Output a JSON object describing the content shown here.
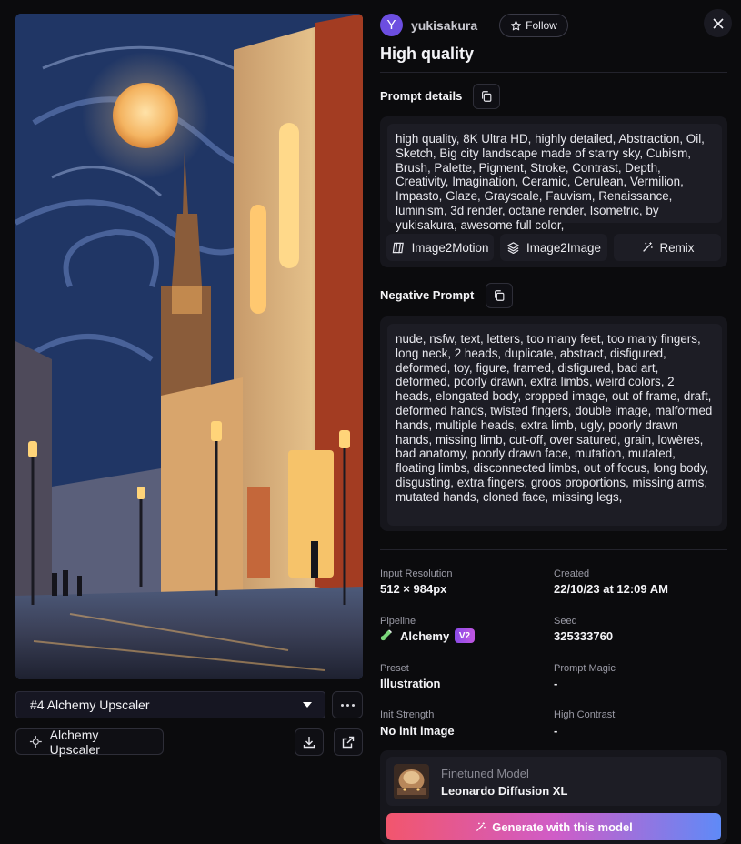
{
  "creator": {
    "avatar_letter": "Y",
    "username": "yukisakura",
    "follow_label": "Follow"
  },
  "image_title": "High quality",
  "prompt": {
    "heading": "Prompt details",
    "text": "high quality, 8K Ultra HD, highly detailed, Abstraction, Oil, Sketch, Big city landscape made of starry sky, Cubism, Brush, Palette, Pigment, Stroke, Contrast, Depth, Creativity, Imagination, Ceramic, Cerulean, Vermilion, Impasto, Glaze, Grayscale, Fauvism, Renaissance, luminism, 3d render, octane render, Isometric, by yukisakura, awesome full color,",
    "actions": {
      "image2motion": "Image2Motion",
      "image2image": "Image2Image",
      "remix": "Remix"
    }
  },
  "negative_prompt": {
    "heading": "Negative Prompt",
    "text": "nude, nsfw, text, letters, too many feet, too many fingers, long neck, 2 heads, duplicate, abstract, disfigured, deformed, toy, figure, framed, disfigured, bad art, deformed, poorly drawn, extra limbs, weird colors, 2 heads, elongated body, cropped image, out of frame, draft, deformed hands, twisted fingers, double image, malformed hands, multiple heads, extra limb, ugly, poorly drawn hands, missing limb, cut-off, over satured, grain, lowères, bad anatomy, poorly drawn face, mutation, mutated, floating limbs, disconnected limbs, out of focus, long body, disgusting, extra fingers, groos proportions, missing arms, mutated hands, cloned face, missing legs,"
  },
  "details": {
    "input_resolution": {
      "label": "Input Resolution",
      "value": "512 × 984px"
    },
    "created": {
      "label": "Created",
      "value": "22/10/23 at 12:09 AM"
    },
    "pipeline": {
      "label": "Pipeline",
      "value": "Alchemy",
      "badge": "V2"
    },
    "seed": {
      "label": "Seed",
      "value": "325333760"
    },
    "preset": {
      "label": "Preset",
      "value": "Illustration"
    },
    "prompt_magic": {
      "label": "Prompt Magic",
      "value": "-"
    },
    "init_strength": {
      "label": "Init Strength",
      "value": "No init image"
    },
    "high_contrast": {
      "label": "High Contrast",
      "value": "-"
    }
  },
  "model": {
    "label": "Finetuned Model",
    "name": "Leonardo Diffusion XL",
    "generate_label": "Generate with this model"
  },
  "variant": {
    "selected": "#4 Alchemy Upscaler",
    "chip_label": "Alchemy Upscaler"
  },
  "icons": {
    "close": "close-icon",
    "copy": "copy-icon",
    "star": "star-icon",
    "download": "download-icon",
    "open": "external-link-icon",
    "magic": "magic-wand-icon",
    "layers": "layers-icon",
    "motion": "motion-icon",
    "alchemy": "flask-icon",
    "upscaler": "upscaler-icon"
  },
  "colors": {
    "background": "#0b0b0d",
    "accent_purple": "#6c4ee0",
    "generate_gradient": [
      "#f2566d",
      "#d05cc7",
      "#5f8af7"
    ]
  }
}
